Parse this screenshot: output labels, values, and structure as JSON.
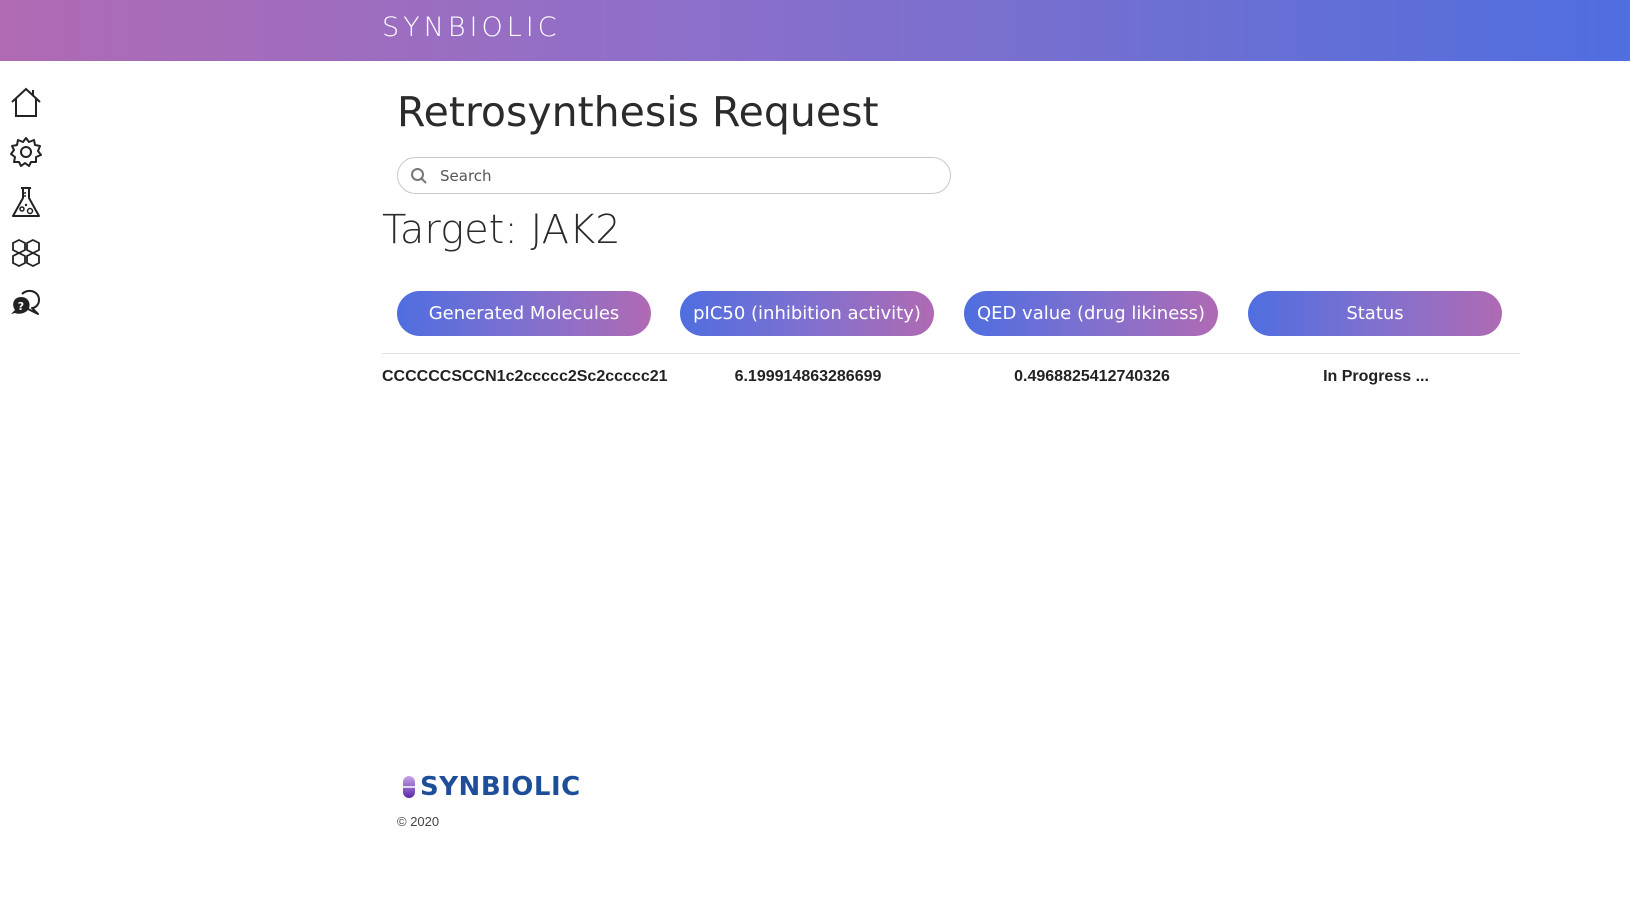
{
  "header": {
    "brand": "SYNBIOLIC"
  },
  "sidebar": {
    "items": [
      {
        "icon": "home-icon"
      },
      {
        "icon": "gear-icon"
      },
      {
        "icon": "flask-icon"
      },
      {
        "icon": "molecule-icon"
      },
      {
        "icon": "help-chat-icon"
      }
    ]
  },
  "main": {
    "title": "Retrosynthesis Request",
    "search": {
      "placeholder": "Search",
      "value": ""
    },
    "target_label": "Target: JAK2",
    "columns": [
      "Generated Molecules",
      "pIC50 (inhibition activity)",
      "QED value (drug likiness)",
      "Status"
    ],
    "rows": [
      {
        "molecule": "CCCCCCSCCN1c2ccccc2Sc2ccccc21",
        "pic50": "6.199914863286699",
        "qed": "0.4968825412740326",
        "status": "In Progress ..."
      }
    ]
  },
  "footer": {
    "logo_text": "SYNBIOLIC",
    "copyright": "© 2020"
  },
  "colors": {
    "header_gradient_start": "#b06ab3",
    "header_gradient_end": "#4f6ee0",
    "pill_gradient_start": "#4f6ee0",
    "pill_gradient_end": "#b06ab3",
    "footer_logo": "#1e4e9a"
  }
}
